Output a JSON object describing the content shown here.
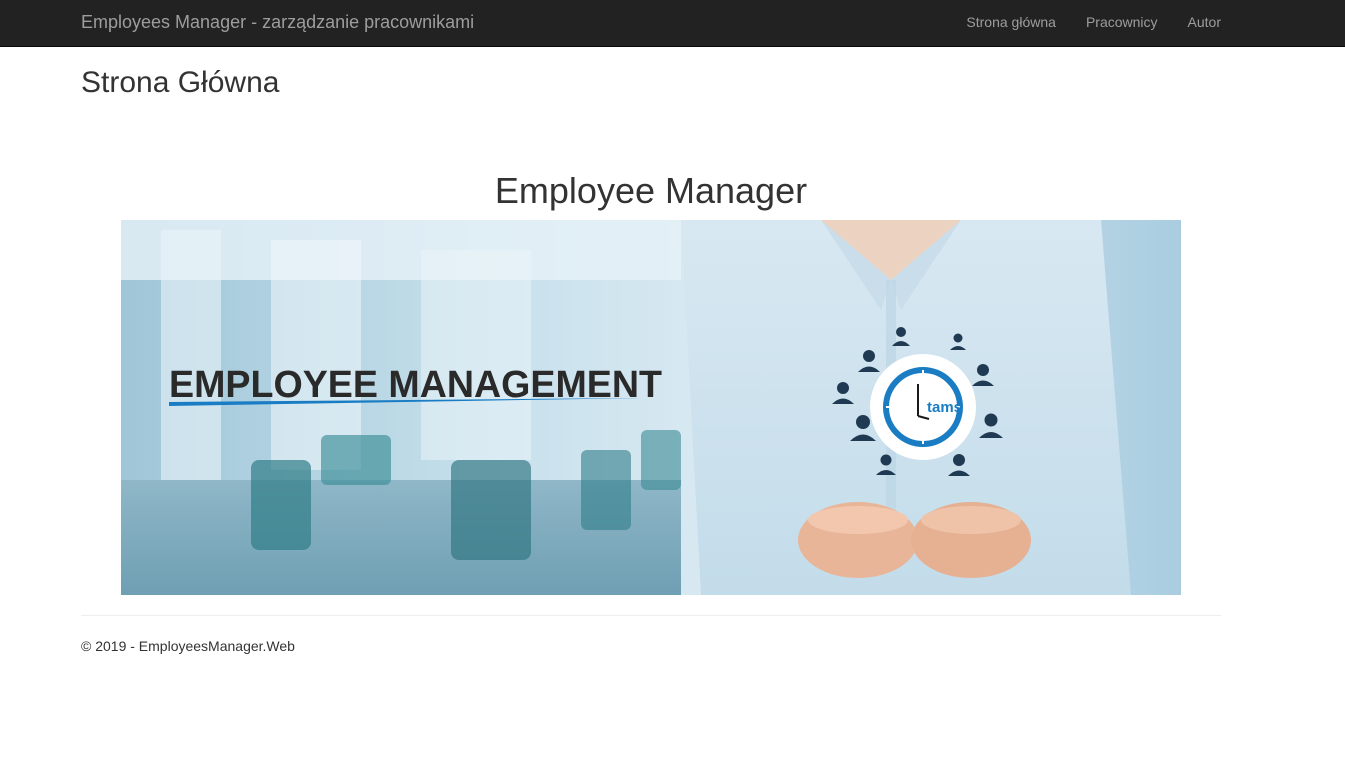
{
  "navbar": {
    "brand": "Employees Manager - zarządzanie pracownikami",
    "links": [
      {
        "label": "Strona główna"
      },
      {
        "label": "Pracownicy"
      },
      {
        "label": "Autor"
      }
    ]
  },
  "main": {
    "page_title": "Strona Główna",
    "heading": "Employee Manager",
    "banner": {
      "headline": "EMPLOYEE MANAGEMENT",
      "logo_text": "tams"
    }
  },
  "footer": {
    "text": "© 2019 - EmployeesManager.Web"
  },
  "colors": {
    "navbar_bg": "#222222",
    "navbar_text": "#9d9d9d",
    "accent_blue": "#1a7dc4",
    "icon_navy": "#1f3a52"
  }
}
